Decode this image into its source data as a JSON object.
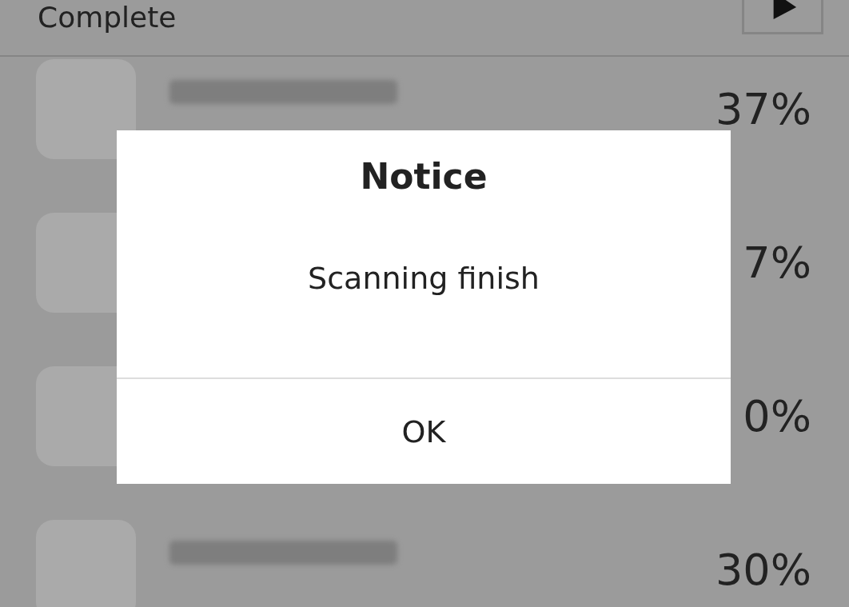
{
  "header": {
    "title": "Complete"
  },
  "apps": [
    {
      "redacted": true,
      "percent": "37%"
    },
    {
      "redacted": false,
      "percent": "7%"
    },
    {
      "redacted": false,
      "percent": "0%"
    },
    {
      "redacted": true,
      "percent": "30%"
    }
  ],
  "dialog": {
    "title": "Notice",
    "message": "Scanning finish",
    "buttons": [
      "OK"
    ]
  }
}
